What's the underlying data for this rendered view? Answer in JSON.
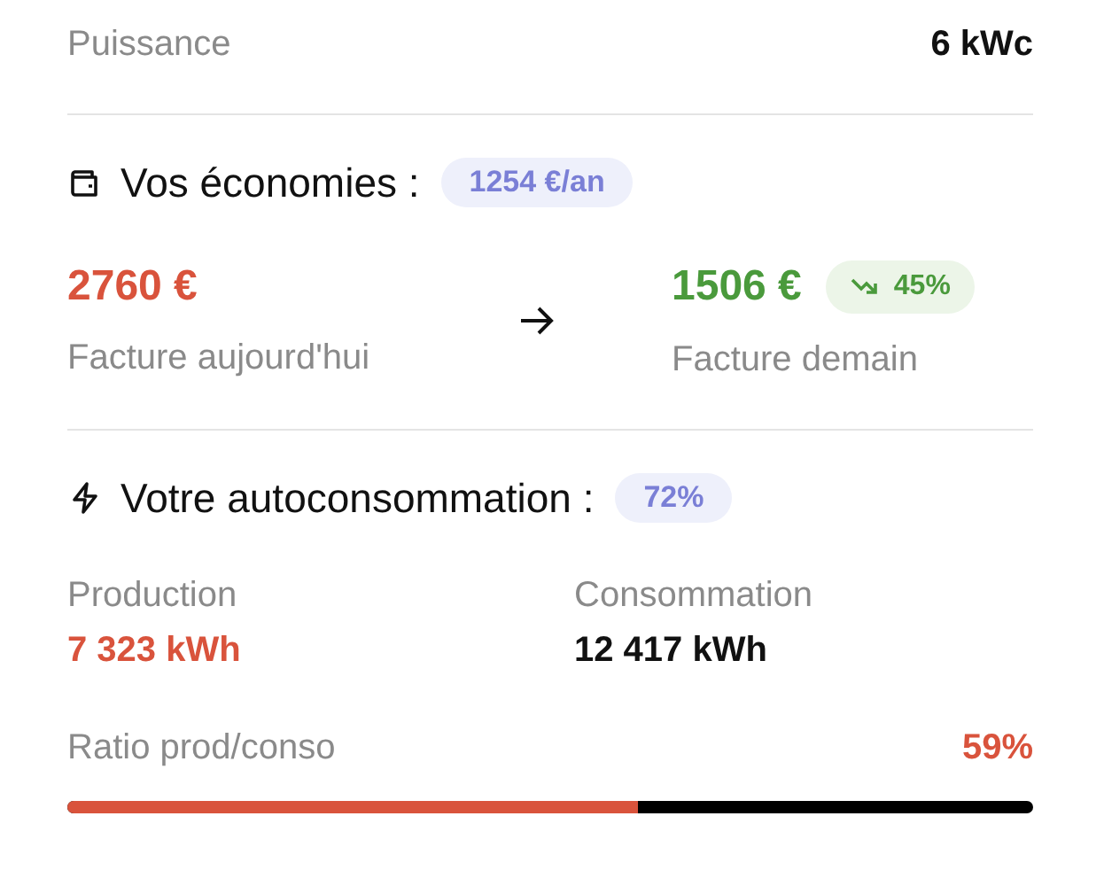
{
  "power": {
    "label": "Puissance",
    "value": "6 kWc"
  },
  "savings": {
    "title": "Vos économies :",
    "badge": "1254 €/an",
    "today": {
      "value": "2760 €",
      "label": "Facture aujourd'hui"
    },
    "tomorrow": {
      "value": "1506 €",
      "label": "Facture demain",
      "change": "45%"
    }
  },
  "self_consumption": {
    "title": "Votre autoconsommation :",
    "badge": "72%",
    "production": {
      "label": "Production",
      "value": "7 323 kWh"
    },
    "consumption": {
      "label": "Consommation",
      "value": "12 417 kWh"
    },
    "ratio": {
      "label": "Ratio prod/conso",
      "reading": "59%",
      "level": 0.59
    }
  }
}
